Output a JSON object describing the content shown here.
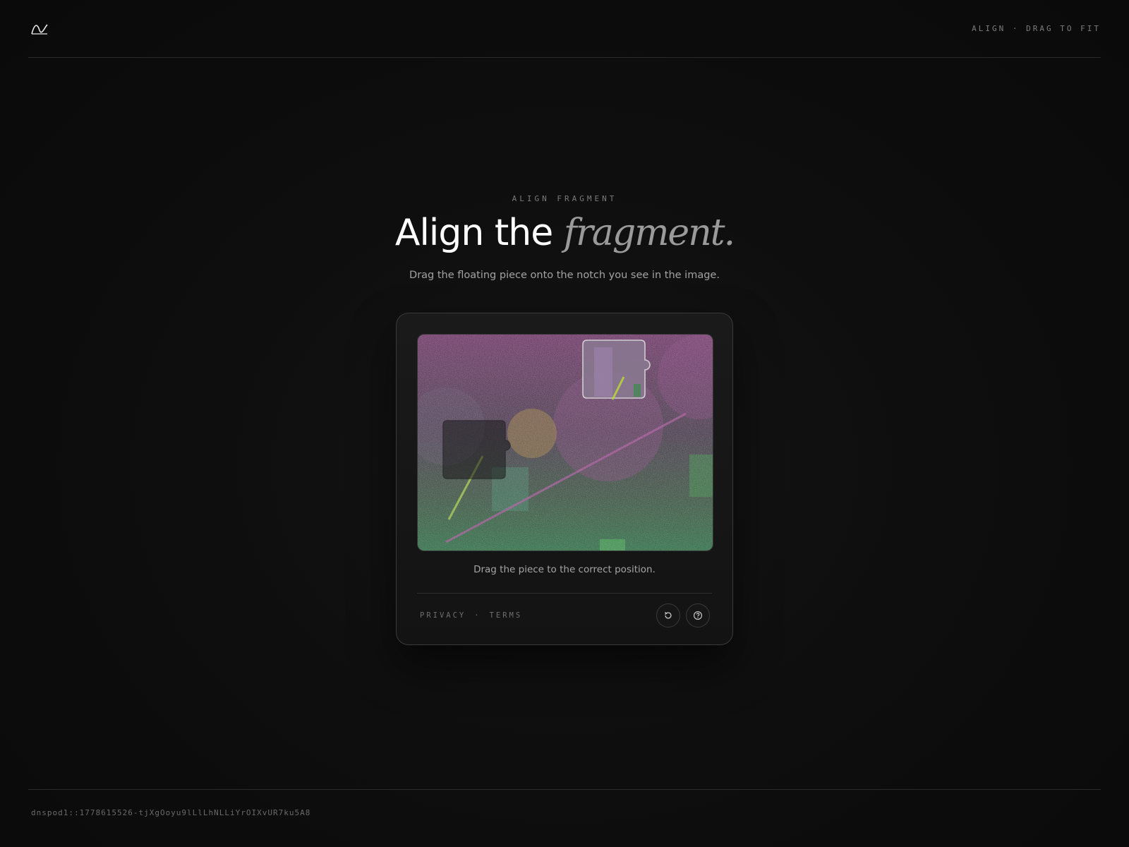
{
  "header": {
    "logo_icon": "wave-logo-icon",
    "right_label": "ALIGN · DRAG TO FIT"
  },
  "hero": {
    "eyebrow": "ALIGN FRAGMENT",
    "title_plain": "Align the ",
    "title_emphasis": "fragment.",
    "subtitle": "Drag the floating piece onto the notch you see in the image."
  },
  "captcha": {
    "hint": "Drag the piece to the correct position.",
    "links": {
      "privacy": "PRIVACY",
      "separator": "·",
      "terms": "TERMS"
    },
    "buttons": {
      "refresh_icon": "refresh-icon",
      "help_icon": "help-icon"
    }
  },
  "footer": {
    "token": "dnspod1::1778615526-tjXgOoyu9lLlLhNLLiYrOIXvUR7ku5A8"
  },
  "colors": {
    "background": "#0b0b0b",
    "card": "#161616",
    "accent_magenta": "#8a2a7a",
    "accent_green": "#2f7a3e",
    "accent_lime": "#9cc43a"
  }
}
